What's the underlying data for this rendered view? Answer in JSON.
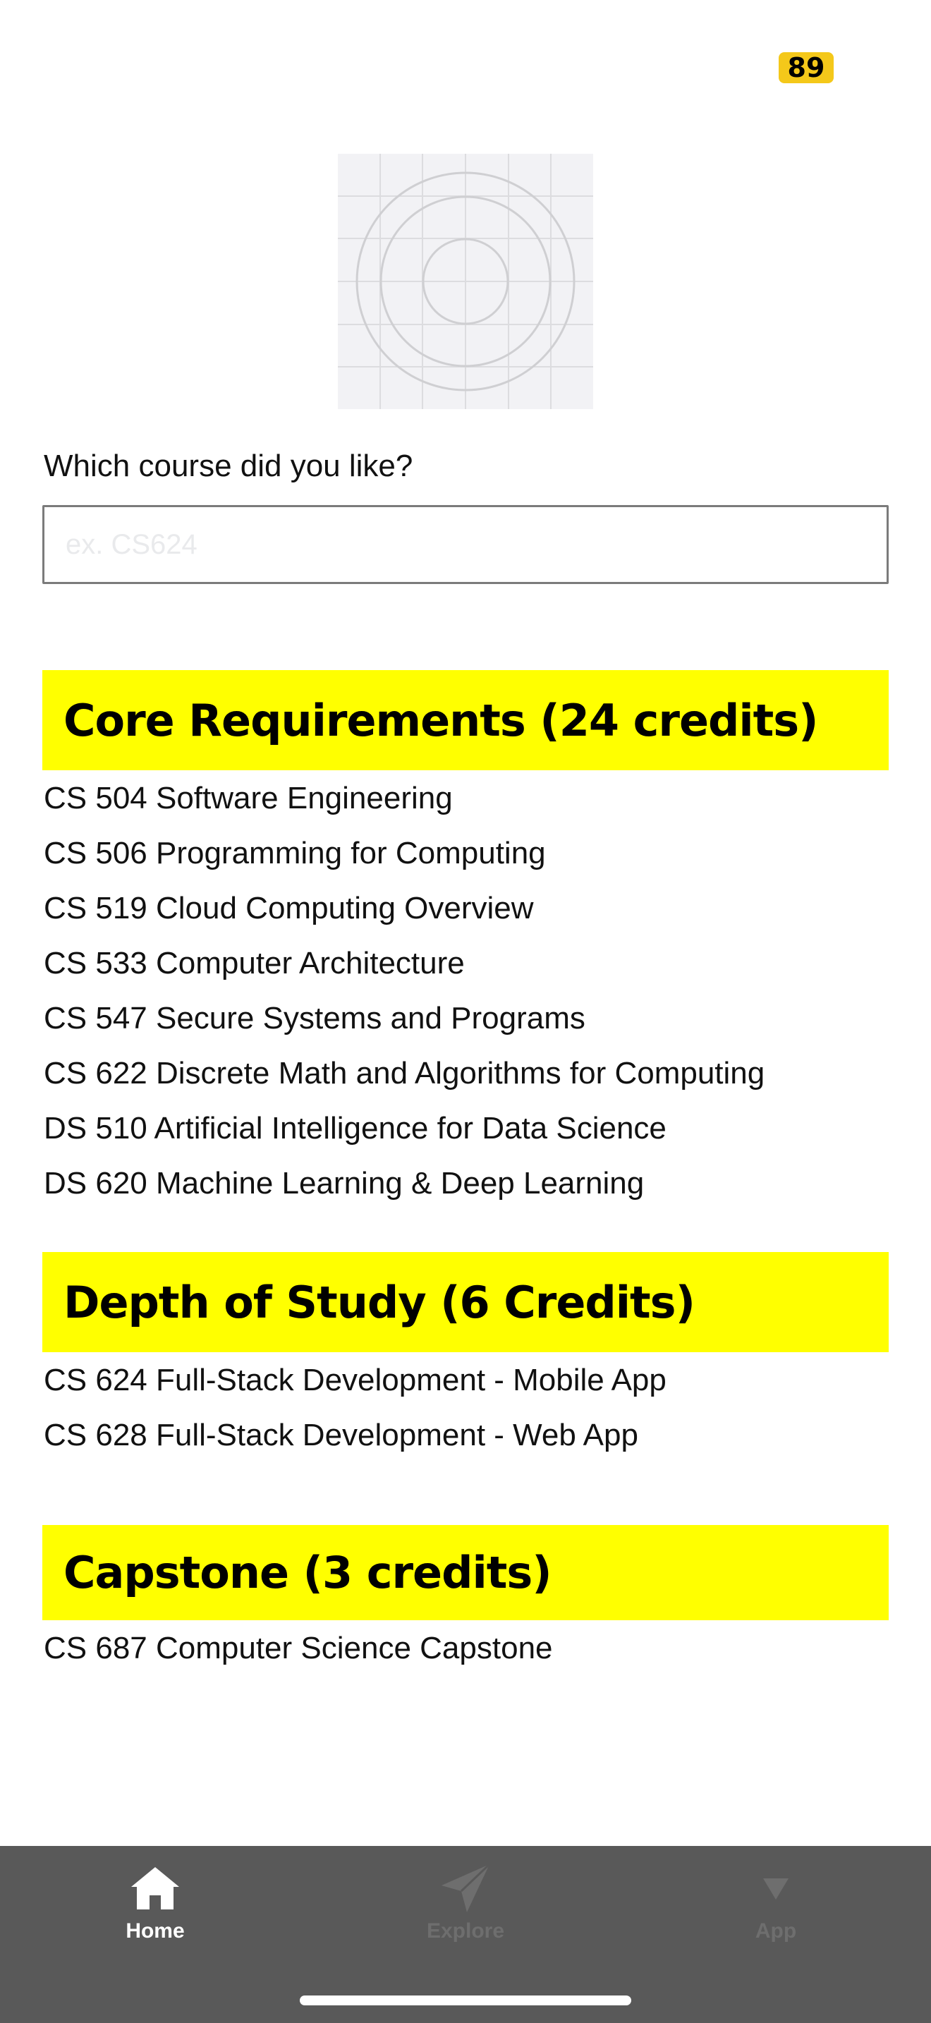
{
  "status_badge": "89",
  "question_label": "Which course did you like?",
  "course_input": {
    "placeholder": "ex. CS624",
    "value": ""
  },
  "sections": [
    {
      "title": "Core Requirements (24 credits)",
      "courses": [
        "CS 504 Software Engineering",
        "CS 506 Programming for Computing",
        "CS 519 Cloud Computing Overview",
        "CS 533 Computer Architecture",
        "CS 547 Secure Systems and Programs",
        "CS 622 Discrete Math and Algorithms for Computing",
        "DS 510 Artificial Intelligence for Data Science",
        "DS 620 Machine Learning & Deep Learning"
      ]
    },
    {
      "title": "Depth of Study (6 Credits)",
      "courses": [
        "CS 624 Full-Stack Development - Mobile App",
        "CS 628 Full-Stack Development - Web App"
      ]
    },
    {
      "title": "Capstone (3 credits)",
      "courses": [
        "CS 687 Computer Science Capstone"
      ]
    }
  ],
  "tab_bar": {
    "tabs": [
      {
        "label": "Home",
        "icon": "home-icon",
        "active": true
      },
      {
        "label": "Explore",
        "icon": "paper-plane-icon",
        "active": false
      },
      {
        "label": "App",
        "icon": "triangle-down-icon",
        "active": false
      }
    ]
  },
  "colors": {
    "section_highlight": "#ffff00",
    "badge": "#f4c81a",
    "tab_bar": "#595959",
    "tab_active": "#ffffff",
    "tab_inactive": "#6e6e6e"
  }
}
